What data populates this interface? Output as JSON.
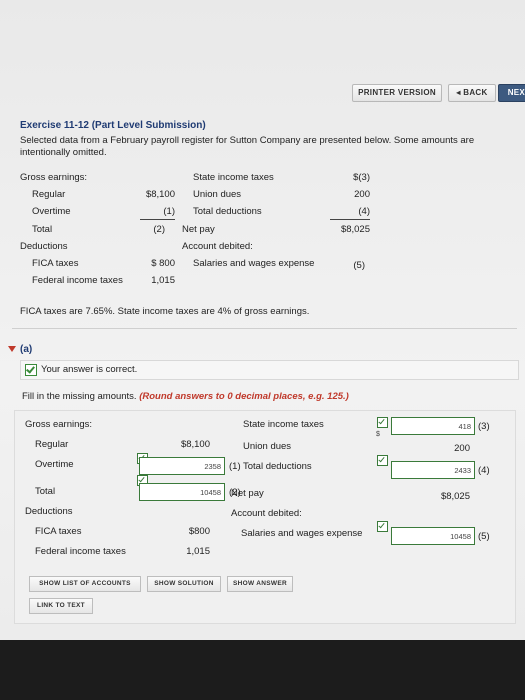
{
  "toolbar": {
    "printer_version": "PRINTER VERSION",
    "back": "BACK",
    "next": "NEXT"
  },
  "exercise": {
    "title": "Exercise 11-12 (Part Level Submission)",
    "intro": "Selected data from a February payroll register for Sutton Company are presented below. Some amounts are intentionally omitted."
  },
  "register": {
    "gross_earnings": "Gross earnings:",
    "regular": "Regular",
    "regular_amt": "$8,100",
    "overtime": "Overtime",
    "overtime_amt": "(1)",
    "total": "Total",
    "total_amt": "(2)",
    "deductions": "Deductions",
    "fica": "FICA taxes",
    "fica_amt": "$ 800",
    "federal": "Federal income taxes",
    "federal_amt": "1,015",
    "state_tax": "State income taxes",
    "state_amt": "$(3)",
    "union_dues": "Union dues",
    "union_amt": "200",
    "total_deductions": "Total deductions",
    "total_ded_amt": "(4)",
    "net_pay": "Net pay",
    "net_amt": "$8,025",
    "account_debited": "Account debited:",
    "salaries": "Salaries and wages expense",
    "salaries_amt": "(5)"
  },
  "note": "FICA taxes are 7.65%. State income taxes are 4% of gross earnings.",
  "part_a": {
    "label": "(a)",
    "correct": "Your answer is correct.",
    "fill_prefix": "Fill in the missing amounts. ",
    "fill_hint": "(Round answers to 0 decimal places, e.g. 125.)"
  },
  "answer": {
    "gross_earnings": "Gross earnings:",
    "regular": "Regular",
    "regular_amt": "$8,100",
    "overtime": "Overtime",
    "overtime_input": "2358",
    "overtime_ref": "(1)",
    "total": "Total",
    "total_input": "10458",
    "total_ref": "(2)",
    "deductions": "Deductions",
    "fica": "FICA taxes",
    "fica_amt": "$800",
    "federal": "Federal income taxes",
    "federal_amt": "1,015",
    "state_tax": "State income taxes",
    "state_input": "418",
    "state_ref": "(3)",
    "dollar": "$",
    "union_dues": "Union dues",
    "union_amt": "200",
    "total_deductions": "Total deductions",
    "total_ded_input": "2433",
    "total_ded_ref": "(4)",
    "net_pay": "Net pay",
    "net_amt": "$8,025",
    "account_debited": "Account debited:",
    "salaries": "Salaries and wages expense",
    "salaries_input": "10458",
    "salaries_ref": "(5)"
  },
  "buttons": {
    "show_list": "SHOW LIST OF ACCOUNTS",
    "show_solution": "SHOW SOLUTION",
    "show_answer": "SHOW ANSWER",
    "link_to_text": "LINK TO TEXT"
  },
  "colors": {
    "title_blue": "#1f3b73",
    "hint_red": "#c0392b",
    "check_green": "#3a7a3a"
  }
}
